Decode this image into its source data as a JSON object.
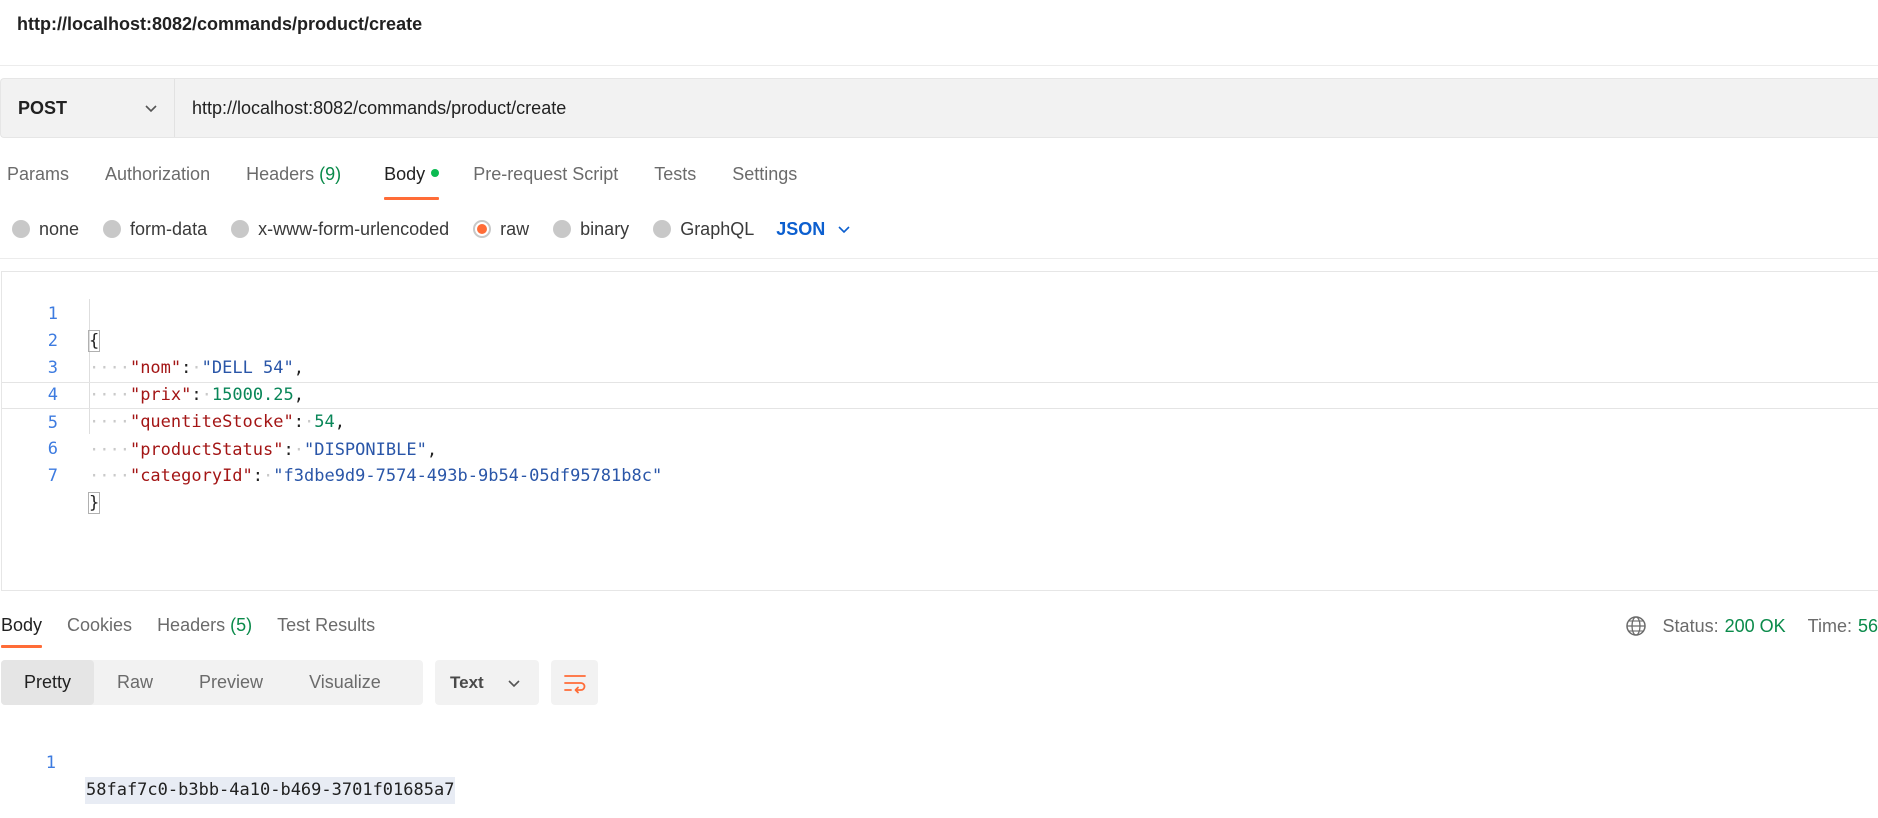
{
  "header": {
    "title": "http://localhost:8082/commands/product/create"
  },
  "request": {
    "method": "POST",
    "url": "http://localhost:8082/commands/product/create"
  },
  "request_tabs": {
    "params": "Params",
    "authorization": "Authorization",
    "headers_label": "Headers",
    "headers_count": "(9)",
    "body": "Body",
    "pre_request": "Pre-request Script",
    "tests": "Tests",
    "settings": "Settings"
  },
  "body_modes": {
    "none": "none",
    "form_data": "form-data",
    "urlencoded": "x-www-form-urlencoded",
    "raw": "raw",
    "binary": "binary",
    "graphql": "GraphQL",
    "language": "JSON",
    "selected": "raw"
  },
  "editor": {
    "line_numbers": [
      "1",
      "2",
      "3",
      "4",
      "5",
      "6",
      "7"
    ],
    "open_brace": "{",
    "close_brace": "}",
    "fields": [
      {
        "key": "\"nom\"",
        "value": "\"DELL 54\"",
        "type": "string",
        "trailing": ","
      },
      {
        "key": "\"prix\"",
        "value": "15000.25",
        "type": "number",
        "trailing": ","
      },
      {
        "key": "\"quentiteStocke\"",
        "value": "54",
        "type": "number",
        "trailing": ","
      },
      {
        "key": "\"productStatus\"",
        "value": "\"DISPONIBLE\"",
        "type": "string",
        "trailing": ","
      },
      {
        "key": "\"categoryId\"",
        "value": "\"f3dbe9d9-7574-493b-9b54-05df95781b8c\"",
        "type": "string",
        "trailing": ""
      }
    ]
  },
  "response_tabs": {
    "body": "Body",
    "cookies": "Cookies",
    "headers_label": "Headers",
    "headers_count": "(5)",
    "test_results": "Test Results"
  },
  "status": {
    "label": "Status:",
    "value": "200 OK",
    "time_label": "Time:",
    "time_value": "56"
  },
  "response_view": {
    "pretty": "Pretty",
    "raw": "Raw",
    "preview": "Preview",
    "visualize": "Visualize",
    "format": "Text"
  },
  "response_body": {
    "line_number": "1",
    "content": "58faf7c0-b3bb-4a10-b469-3701f01685a7"
  },
  "colors": {
    "accent": "#ff6c37",
    "success": "#0a8a4a",
    "link": "#0c5fcf"
  }
}
